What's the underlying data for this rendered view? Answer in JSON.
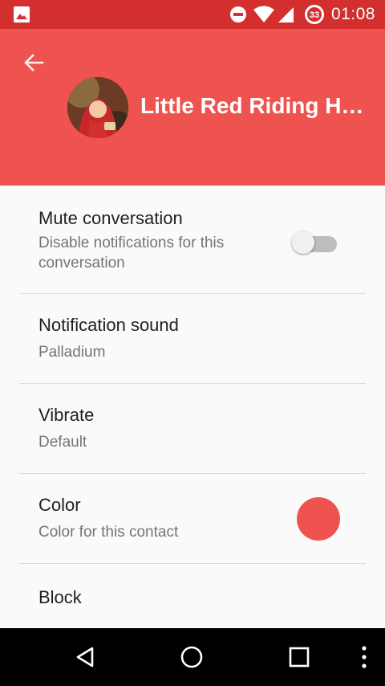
{
  "status_bar": {
    "time": "01:08",
    "battery_level": "33",
    "icons": [
      "image-notification-icon",
      "do-not-disturb-icon",
      "wifi-icon",
      "cell-signal-icon",
      "battery-icon"
    ]
  },
  "app_bar": {
    "title": "Little Red Riding H…",
    "color": "#ef5350"
  },
  "settings": {
    "mute": {
      "title": "Mute conversation",
      "subtitle": "Disable notifications for this conversation",
      "enabled": false
    },
    "sound": {
      "title": "Notification sound",
      "subtitle": "Palladium"
    },
    "vibrate": {
      "title": "Vibrate",
      "subtitle": "Default"
    },
    "color": {
      "title": "Color",
      "subtitle": "Color for this contact",
      "value": "#ef5350"
    },
    "block": {
      "title": "Block"
    }
  },
  "colors": {
    "status_bar": "#d32f2f",
    "accent": "#ef5350"
  },
  "nav_bar": {
    "icons": [
      "back-triangle-icon",
      "home-circle-icon",
      "recents-square-icon",
      "overflow-menu-icon"
    ]
  }
}
